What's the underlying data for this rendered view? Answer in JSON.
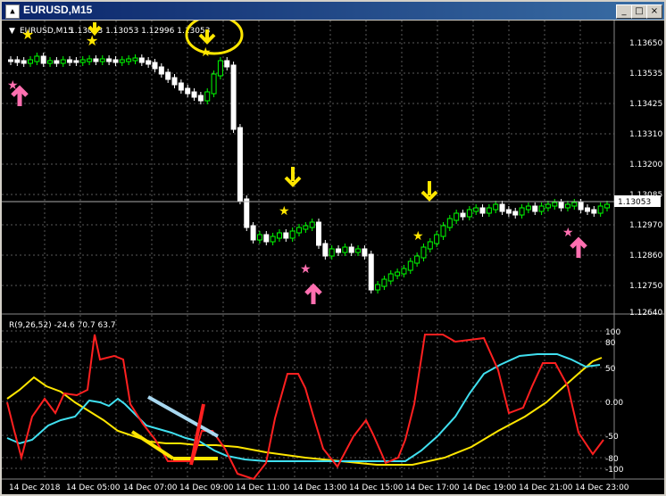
{
  "window": {
    "title": "EURUSD,M15",
    "icon": "chart-window-icon",
    "buttons": {
      "minimize": "_",
      "maximize": "□",
      "close": "×"
    }
  },
  "main_chart": {
    "symbol_label": "EURUSD,M15",
    "ohlc_label": "1.13053 1.13053 1.12996 1.13053",
    "current_price": "1.13053",
    "price_ticks": [
      "1.13650",
      "1.13535",
      "1.13425",
      "1.13310",
      "1.13200",
      "1.13085",
      "1.12970",
      "1.12860",
      "1.12750",
      "1.12640"
    ],
    "colors": {
      "bull": "#00ff00",
      "bear": "#ffffff",
      "grid": "#6a6a6a",
      "arrow_down": "#ffe600",
      "arrow_up": "#ff6fb0"
    }
  },
  "indicator": {
    "label": "R(9,26,52) -24.6 70.7 63.7",
    "ticks": [
      "100",
      "80",
      "50",
      "0.00",
      "-50",
      "-80",
      "-100"
    ],
    "colors": {
      "fast": "#ff2020",
      "mid": "#40e0f0",
      "slow": "#ffe600"
    }
  },
  "time_axis": [
    "14 Dec 2018",
    "14 Dec 05:00",
    "14 Dec 07:00",
    "14 Dec 09:00",
    "14 Dec 11:00",
    "14 Dec 13:00",
    "14 Dec 15:00",
    "14 Dec 17:00",
    "14 Dec 19:00",
    "14 Dec 21:00",
    "14 Dec 23:00"
  ]
}
